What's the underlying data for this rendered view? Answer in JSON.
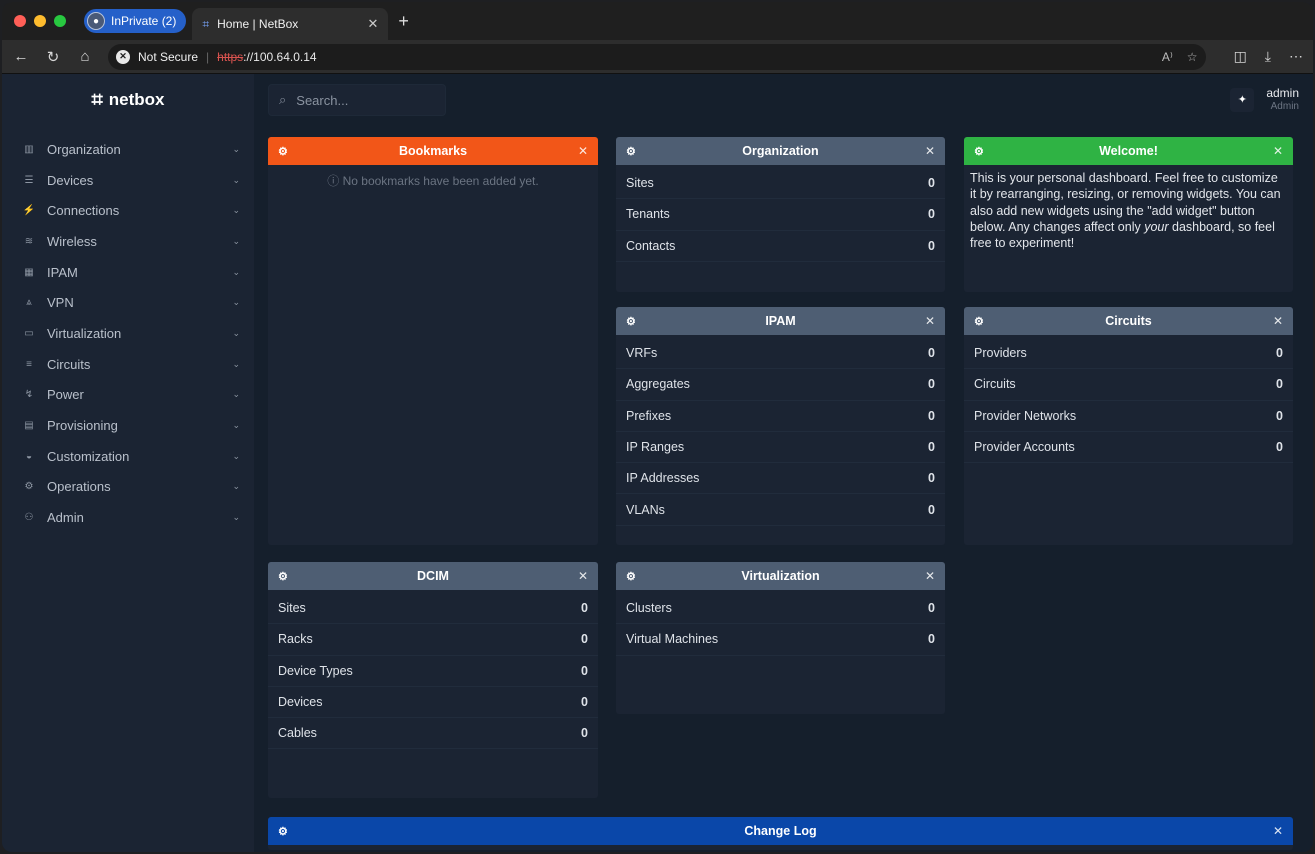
{
  "browser": {
    "inprivate_label": "InPrivate (2)",
    "tab_title": "Home | NetBox",
    "not_secure": "Not Secure",
    "url_scheme": "https",
    "url_rest": "://100.64.0.14",
    "traffic": [
      "#ff5f57",
      "#febc2e",
      "#28c840"
    ]
  },
  "app": {
    "brand": "netbox",
    "search_placeholder": "Search...",
    "user_name": "admin",
    "user_role": "Admin"
  },
  "nav": [
    {
      "label": "Organization",
      "icon": "building-icon",
      "glyph": "▥"
    },
    {
      "label": "Devices",
      "icon": "server-icon",
      "glyph": "☰"
    },
    {
      "label": "Connections",
      "icon": "plug-icon",
      "glyph": "⚡"
    },
    {
      "label": "Wireless",
      "icon": "wifi-icon",
      "glyph": "≋"
    },
    {
      "label": "IPAM",
      "icon": "counter-icon",
      "glyph": "▦"
    },
    {
      "label": "VPN",
      "icon": "tunnel-icon",
      "glyph": "⩓"
    },
    {
      "label": "Virtualization",
      "icon": "monitor-icon",
      "glyph": "▭"
    },
    {
      "label": "Circuits",
      "icon": "circuit-icon",
      "glyph": "≡"
    },
    {
      "label": "Power",
      "icon": "power-icon",
      "glyph": "↯"
    },
    {
      "label": "Provisioning",
      "icon": "file-icon",
      "glyph": "▤"
    },
    {
      "label": "Customization",
      "icon": "palette-icon",
      "glyph": "◒"
    },
    {
      "label": "Operations",
      "icon": "cogs-icon",
      "glyph": "⚙"
    },
    {
      "label": "Admin",
      "icon": "users-icon",
      "glyph": "⚇"
    }
  ],
  "widgets": {
    "bookmarks": {
      "title": "Bookmarks",
      "color": "#f25618",
      "empty": "ⓘ No bookmarks have been added yet."
    },
    "organization": {
      "title": "Organization",
      "color": "#4e5e73",
      "rows": [
        {
          "label": "Sites",
          "count": "0"
        },
        {
          "label": "Tenants",
          "count": "0"
        },
        {
          "label": "Contacts",
          "count": "0"
        }
      ]
    },
    "welcome": {
      "title": "Welcome!",
      "color": "#2fb344",
      "text_1": "This is your personal dashboard. Feel free to customize it by rearranging, resizing, or removing widgets. You can also add new widgets using the \"add widget\" button below. Any changes affect only ",
      "text_em": "your",
      "text_2": " dashboard, so feel free to experiment!"
    },
    "ipam": {
      "title": "IPAM",
      "color": "#4e5e73",
      "rows": [
        {
          "label": "VRFs",
          "count": "0"
        },
        {
          "label": "Aggregates",
          "count": "0"
        },
        {
          "label": "Prefixes",
          "count": "0"
        },
        {
          "label": "IP Ranges",
          "count": "0"
        },
        {
          "label": "IP Addresses",
          "count": "0"
        },
        {
          "label": "VLANs",
          "count": "0"
        }
      ]
    },
    "circuits": {
      "title": "Circuits",
      "color": "#4e5e73",
      "rows": [
        {
          "label": "Providers",
          "count": "0"
        },
        {
          "label": "Circuits",
          "count": "0"
        },
        {
          "label": "Provider Networks",
          "count": "0"
        },
        {
          "label": "Provider Accounts",
          "count": "0"
        }
      ]
    },
    "dcim": {
      "title": "DCIM",
      "color": "#4e5e73",
      "rows": [
        {
          "label": "Sites",
          "count": "0"
        },
        {
          "label": "Racks",
          "count": "0"
        },
        {
          "label": "Device Types",
          "count": "0"
        },
        {
          "label": "Devices",
          "count": "0"
        },
        {
          "label": "Cables",
          "count": "0"
        }
      ]
    },
    "virtualization": {
      "title": "Virtualization",
      "color": "#4e5e73",
      "rows": [
        {
          "label": "Clusters",
          "count": "0"
        },
        {
          "label": "Virtual Machines",
          "count": "0"
        }
      ]
    },
    "changelog": {
      "title": "Change Log",
      "color": "#0a47a9"
    }
  }
}
